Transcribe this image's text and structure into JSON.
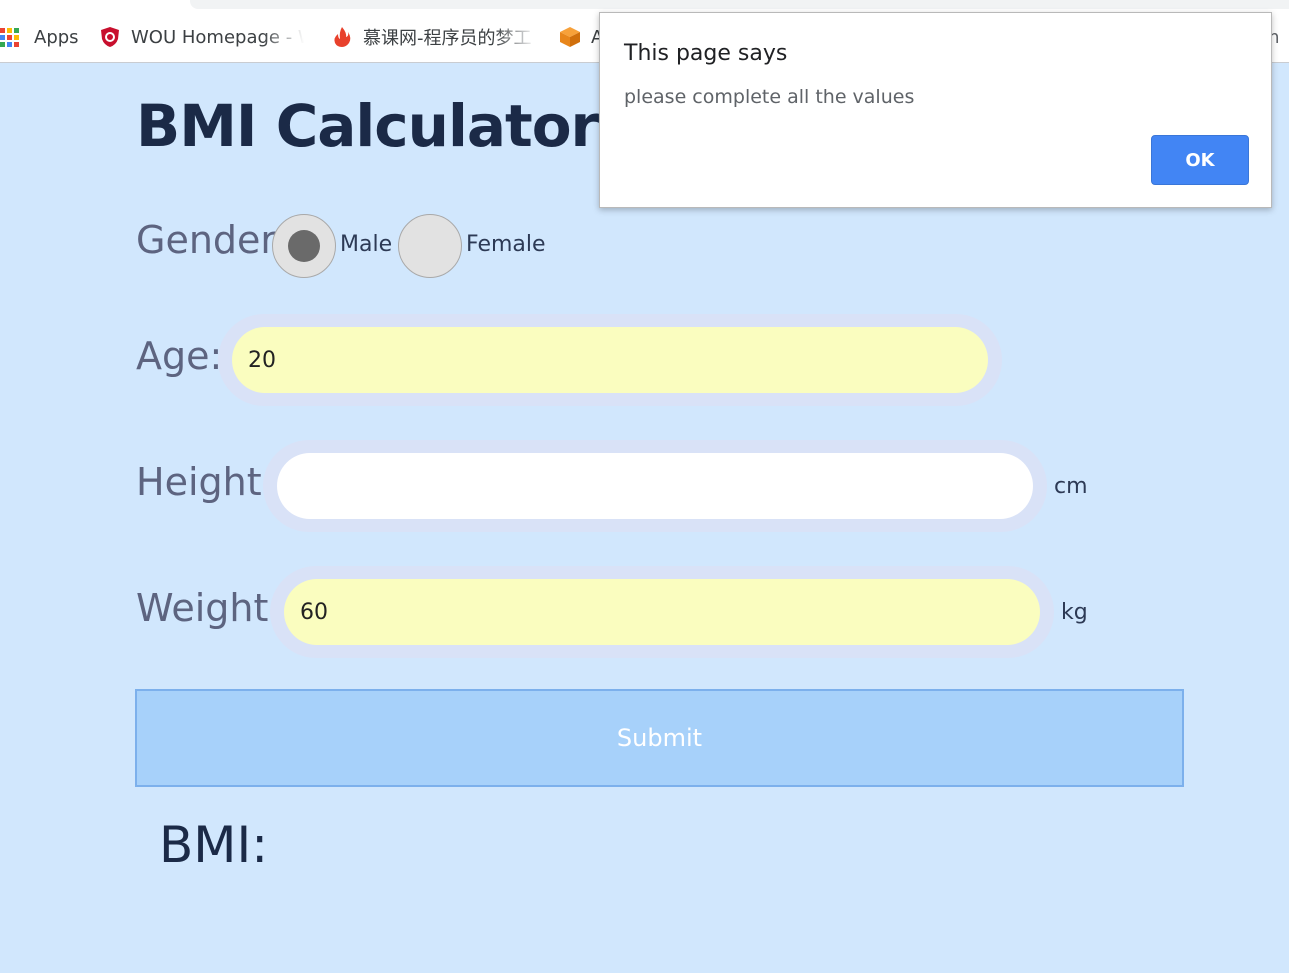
{
  "bookmarks": {
    "apps_label": "Apps",
    "wou_label": "WOU Homepage - W",
    "imooc_label": "慕课网-程序员的梦工",
    "box_label": "A",
    "right_label": "m"
  },
  "page": {
    "title": "BMI Calculator",
    "gender_label": "Gender:",
    "male_label": "Male",
    "female_label": "Female",
    "selected_gender": "Male",
    "age_label": "Age:",
    "age_value": "20",
    "height_label": "Height:",
    "height_value": "",
    "height_unit": "cm",
    "weight_label": "Weight:",
    "weight_value": "60",
    "weight_unit": "kg",
    "submit_label": "Submit",
    "bmi_label": "BMI:"
  },
  "dialog": {
    "title": "This page says",
    "message": "please complete all the values",
    "ok_label": "OK"
  },
  "colors": {
    "page_background": "#d1e7fd",
    "autofill_yellow": "#fafdbf",
    "submit_background": "#a7d1fa",
    "ok_button": "#4285f4"
  }
}
